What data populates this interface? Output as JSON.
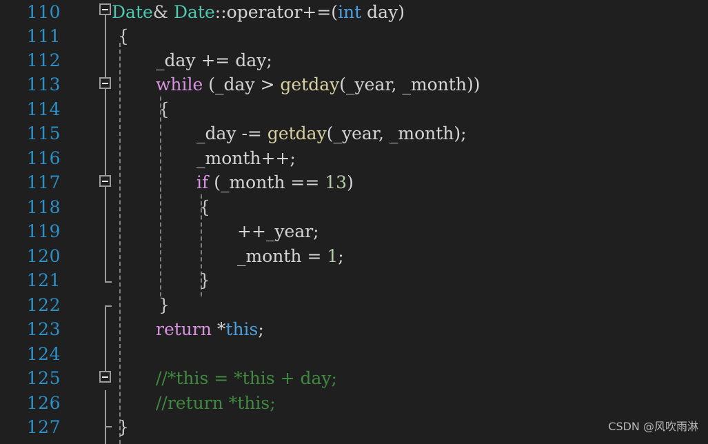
{
  "editor": {
    "background_color": "#1f1f1f",
    "line_number_color": "#2b91c8",
    "first_line": 110,
    "last_line": 127
  },
  "colors": {
    "plain": "#d4d4d4",
    "keyword_control": "#d892e0",
    "keyword_type": "#4a9fe0",
    "class_name": "#4ec9b0",
    "function_name": "#d6d0a0",
    "number": "#b5cea8",
    "comment": "#3f8a3f",
    "fold_marker": "#9c9c9c",
    "indent_guide": "#808080"
  },
  "lines": [
    {
      "n": "110",
      "fold": "start",
      "indent": 0
    },
    {
      "n": "111",
      "fold": "line",
      "indent": 0
    },
    {
      "n": "112",
      "fold": "line",
      "indent": 1
    },
    {
      "n": "113",
      "fold": "start",
      "indent": 1
    },
    {
      "n": "114",
      "fold": "line",
      "indent": 1
    },
    {
      "n": "115",
      "fold": "line",
      "indent": 2
    },
    {
      "n": "116",
      "fold": "line",
      "indent": 2
    },
    {
      "n": "117",
      "fold": "start",
      "indent": 2
    },
    {
      "n": "118",
      "fold": "line",
      "indent": 2
    },
    {
      "n": "119",
      "fold": "line",
      "indent": 3
    },
    {
      "n": "120",
      "fold": "line",
      "indent": 3
    },
    {
      "n": "121",
      "fold": "end",
      "indent": 2
    },
    {
      "n": "122",
      "fold": "end",
      "indent": 1
    },
    {
      "n": "123",
      "fold": "line",
      "indent": 1
    },
    {
      "n": "124",
      "fold": "line",
      "indent": 1
    },
    {
      "n": "125",
      "fold": "start",
      "indent": 1
    },
    {
      "n": "126",
      "fold": "line",
      "indent": 1
    },
    {
      "n": "127",
      "fold": "end",
      "indent": 0
    }
  ],
  "source": {
    "line_110": "Date& Date::operator+=(int day)",
    "line_111": "{",
    "line_112": "_day += day;",
    "line_113": "while (_day > getday(_year, _month))",
    "line_114": "{",
    "line_115": "_day -= getday(_year, _month);",
    "line_116": "_month++;",
    "line_117": "if (_month == 13)",
    "line_118": "{",
    "line_119": "++_year;",
    "line_120": "_month = 1;",
    "line_121": "}",
    "line_122": "}",
    "line_123": "return *this;",
    "line_124": "",
    "line_125": "//*this = *this + day;",
    "line_126": "//return *this;",
    "line_127": "}"
  },
  "tokens": {
    "t110": {
      "cls": "Date",
      "amp": "& ",
      "cls2": "Date",
      "scope": "::",
      "op": "operator+=(",
      "type": "int",
      "arg": " day)"
    },
    "t112": {
      "a": "_day += day;"
    },
    "t113": {
      "kw": "while",
      "a": " (_day > ",
      "fn": "getday",
      "b": "(_year, _month))"
    },
    "t115": {
      "a": "_day -= ",
      "fn": "getday",
      "b": "(_year, _month);"
    },
    "t116": {
      "a": "_month++;"
    },
    "t117": {
      "kw": "if",
      "a": " (_month == ",
      "num": "13",
      "b": ")"
    },
    "t119": {
      "a": "++_year;"
    },
    "t120": {
      "a": "_month = ",
      "num": "1",
      "b": ";"
    },
    "t123": {
      "kw": "return",
      "a": " *",
      "type": "this",
      "b": ";"
    },
    "t125": {
      "cmt": "//*this = *this + day;"
    },
    "t126": {
      "cmt": "//return *this;"
    },
    "brace_open": "{",
    "brace_close": "}"
  },
  "watermark": {
    "text": "CSDN @风吹雨淋"
  }
}
